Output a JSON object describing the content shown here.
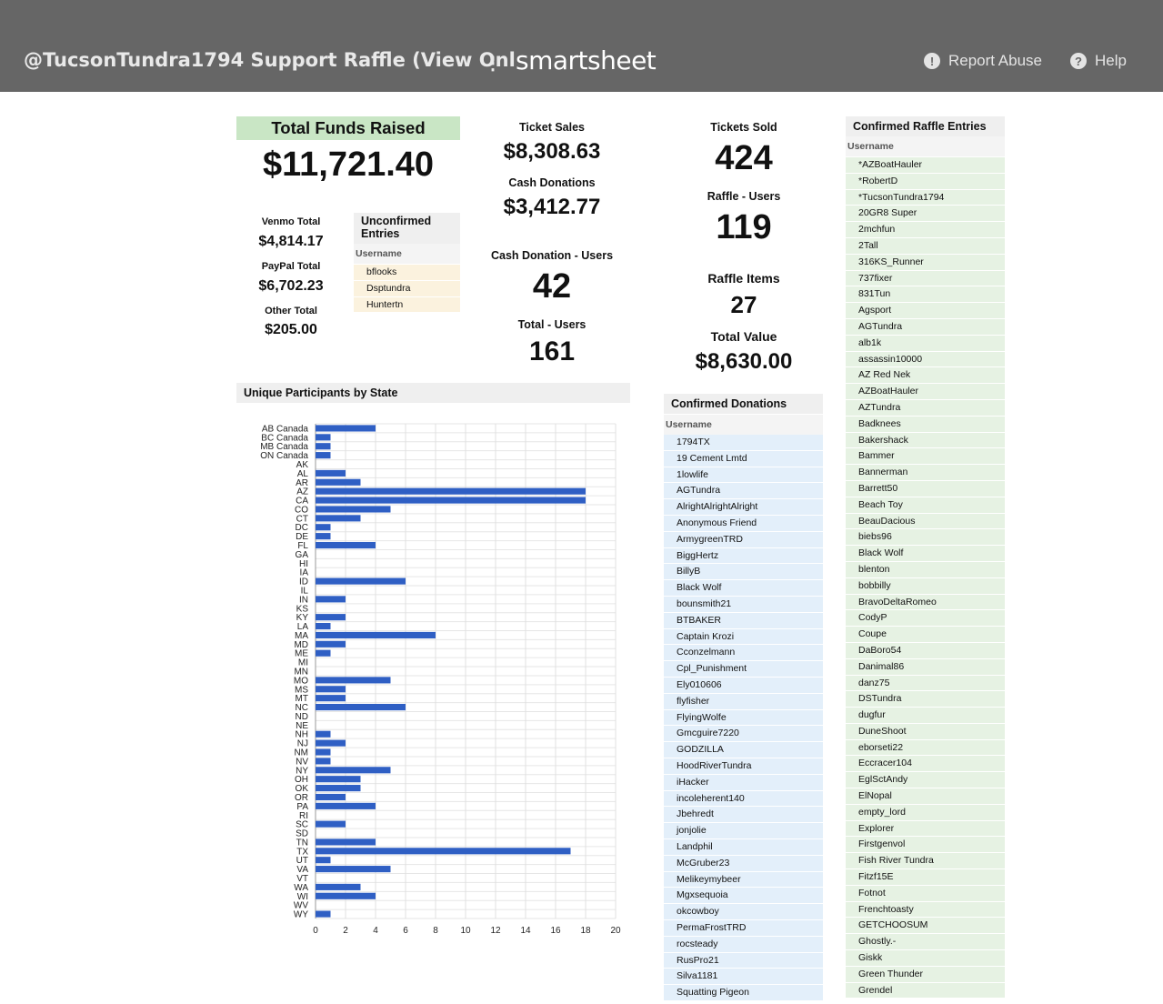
{
  "header": {
    "title": "@TucsonTundra1794 Support Raffle (View Onl",
    "menu_icon": "kebab-menu-icon",
    "brand": "smartsheet",
    "report_abuse": "Report Abuse",
    "report_abuse_icon": "exclamation-circle-icon",
    "help": "Help",
    "help_icon": "question-circle-icon"
  },
  "funds": {
    "title": "Total Funds Raised",
    "total": "$11,721.40",
    "venmo_label": "Venmo Total",
    "venmo_value": "$4,814.17",
    "paypal_label": "PayPal Total",
    "paypal_value": "$6,702.23",
    "other_label": "Other Total",
    "other_value": "$205.00"
  },
  "unconfirmed": {
    "title_line1": "Unconfirmed",
    "title_line2": "Entries",
    "column": "Username",
    "entries": [
      "bflooks",
      "Dsptundra",
      "Huntertn"
    ]
  },
  "stats_mid": {
    "ticket_sales_label": "Ticket Sales",
    "ticket_sales_value": "$8,308.63",
    "cash_donations_label": "Cash Donations",
    "cash_donations_value": "$3,412.77",
    "cash_users_label": "Cash Donation - Users",
    "cash_users_value": "42",
    "total_users_label": "Total - Users",
    "total_users_value": "161"
  },
  "stats_right": {
    "tickets_sold_label": "Tickets Sold",
    "tickets_sold_value": "424",
    "raffle_users_label": "Raffle - Users",
    "raffle_users_value": "119",
    "raffle_items_label": "Raffle Items",
    "raffle_items_value": "27",
    "total_value_label": "Total Value",
    "total_value_value": "$8,630.00"
  },
  "chart_panel": {
    "title": "Unique Participants by State"
  },
  "chart_data": {
    "type": "bar",
    "orientation": "horizontal",
    "categories": [
      "AB Canada",
      "BC Canada",
      "MB Canada",
      "ON Canada",
      "AK",
      "AL",
      "AR",
      "AZ",
      "CA",
      "CO",
      "CT",
      "DC",
      "DE",
      "FL",
      "GA",
      "HI",
      "IA",
      "ID",
      "IL",
      "IN",
      "KS",
      "KY",
      "LA",
      "MA",
      "MD",
      "ME",
      "MI",
      "MN",
      "MO",
      "MS",
      "MT",
      "NC",
      "ND",
      "NE",
      "NH",
      "NJ",
      "NM",
      "NV",
      "NY",
      "OH",
      "OK",
      "OR",
      "PA",
      "RI",
      "SC",
      "SD",
      "TN",
      "TX",
      "UT",
      "VA",
      "VT",
      "WA",
      "WI",
      "WV",
      "WY"
    ],
    "values": [
      4,
      1,
      1,
      1,
      0,
      2,
      3,
      18,
      18,
      5,
      3,
      1,
      1,
      4,
      0,
      0,
      0,
      6,
      0,
      2,
      0,
      2,
      1,
      8,
      2,
      1,
      0,
      0,
      5,
      2,
      2,
      6,
      0,
      0,
      1,
      2,
      1,
      1,
      5,
      3,
      3,
      2,
      4,
      0,
      2,
      0,
      4,
      17,
      1,
      5,
      0,
      3,
      4,
      0,
      1
    ],
    "xlim": [
      0,
      20
    ],
    "xticks": [
      "0",
      "2",
      "4",
      "6",
      "8",
      "10",
      "12",
      "14",
      "16",
      "18",
      "20"
    ],
    "grid": true,
    "bar_color": "#2f5fc4"
  },
  "confirmed_donations": {
    "title": "Confirmed Donations",
    "column": "Username",
    "entries": [
      "1794TX",
      "19 Cement Lmtd",
      "1lowlife",
      "AGTundra",
      "AlrightAlrightAlright",
      "Anonymous Friend",
      "ArmygreenTRD",
      "BiggHertz",
      "BillyB",
      "Black Wolf",
      "bounsmith21",
      "BTBAKER",
      "Captain Krozi",
      "Cconzelmann",
      "Cpl_Punishment",
      "Ely010606",
      "flyfisher",
      "FlyingWolfe",
      "Gmcguire7220",
      "GODZILLA",
      "HoodRiverTundra",
      "iHacker",
      "incoleherent140",
      "Jbehredt",
      "jonjolie",
      "Landphil",
      "McGruber23",
      "Melikeymybeer",
      "Mgxsequoia",
      "okcowboy",
      "PermaFrostTRD",
      "rocsteady",
      "RusPro21",
      "Silva1181",
      "Squatting Pigeon"
    ]
  },
  "confirmed_raffle": {
    "title": "Confirmed Raffle Entries",
    "column": "Username",
    "entries": [
      "*AZBoatHauler",
      "*RobertD",
      "*TucsonTundra1794",
      "20GR8 Super",
      "2mchfun",
      "2Tall",
      "316KS_Runner",
      "737fixer",
      "831Tun",
      "Agsport",
      "AGTundra",
      "alb1k",
      "assassin10000",
      "AZ Red Nek",
      "AZBoatHauler",
      "AZTundra",
      "Badknees",
      "Bakershack",
      "Bammer",
      "Bannerman",
      "Barrett50",
      "Beach Toy",
      "BeauDacious",
      "biebs96",
      "Black Wolf",
      "blenton",
      "bobbilly",
      "BravoDeltaRomeo",
      "CodyP",
      "Coupe",
      "DaBoro54",
      "Danimal86",
      "danz75",
      "DSTundra",
      "dugfur",
      "DuneShoot",
      "eborseti22",
      "Eccracer104",
      "EglSctAndy",
      "ElNopal",
      "empty_lord",
      "Explorer",
      "Firstgenvol",
      "Fish River Tundra",
      "Fitzf15E",
      "Fotnot",
      "Frenchtoasty",
      "GETCHOOSUM",
      "Ghostly.-",
      "Giskk",
      "Green Thunder",
      "Grendel"
    ]
  }
}
